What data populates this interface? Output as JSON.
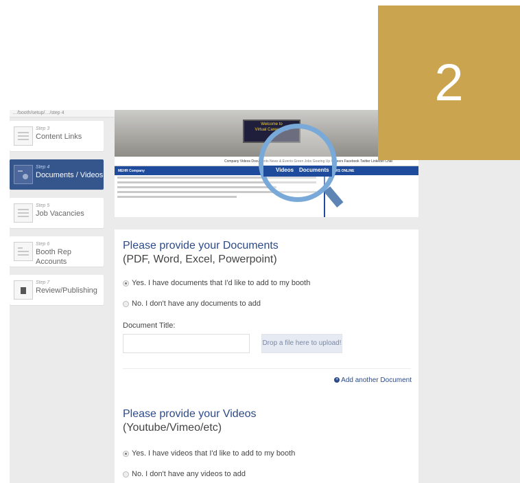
{
  "badge": {
    "number": "2"
  },
  "url": "…/booth/setup/…/step 4",
  "sidebar": {
    "items": [
      {
        "step": "Step 3",
        "label": "Content Links",
        "active": false
      },
      {
        "step": "Step 4",
        "label": "Documents / Videos",
        "active": true
      },
      {
        "step": "Step 5",
        "label": "Job Vacancies",
        "active": false
      },
      {
        "step": "Step 6",
        "label": "Booth Rep Accounts",
        "active": false
      },
      {
        "step": "Step 7",
        "label": "Review/Publishing",
        "active": false
      }
    ]
  },
  "preview": {
    "banner_line1": "Welcome to",
    "banner_line2": "Virtual Career Fair",
    "nav_text": "Company  Videos  Documents  News & Events  Green Jobs  Gearing Up  Careers  Facebook  Twitter  LinkedIn  Chat",
    "bar_left": "MEHR Company",
    "bar_right": "USERS ONLINE",
    "lens_tab1": "Videos",
    "lens_tab2": "Documents"
  },
  "documents": {
    "title": "Please provide your Documents",
    "subtitle": "(PDF, Word, Excel, Powerpoint)",
    "option_yes": "Yes. I have documents that I'd like to add to my booth",
    "option_no": "No. I don't have any documents to add",
    "field_label": "Document Title:",
    "title_value": "",
    "drop_label": "Drop a file here to upload!",
    "add_label": "Add another Document"
  },
  "videos": {
    "title": "Please provide your Videos",
    "subtitle": "(Youtube/Vimeo/etc)",
    "option_yes": "Yes. I have videos that I'd like to add to my booth",
    "option_no": "No. I don't have any videos to add"
  },
  "colors": {
    "accent": "#35558d",
    "badge": "#caa44f",
    "heading": "#2c4a8a"
  }
}
